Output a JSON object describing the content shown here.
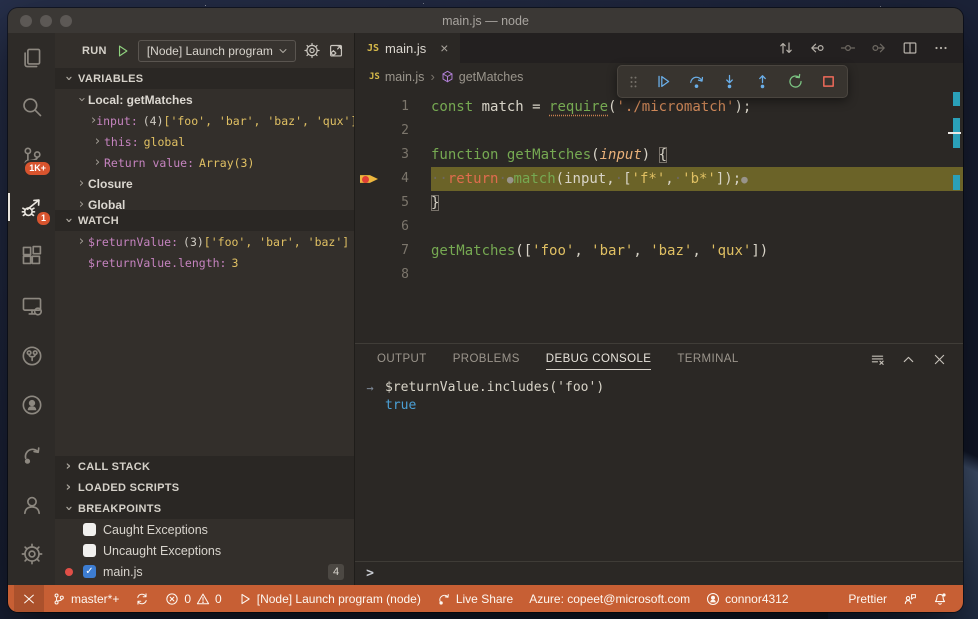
{
  "window_title": "main.js — node",
  "colors": {
    "status_bar": "#c75f34",
    "badge_orange": "#d8542e",
    "debug_blue": "#6aaee8",
    "restart_green": "#7cc583",
    "stop_red": "#ef6a5a",
    "keyword_green": "#76a952",
    "string_yellow": "#e0c063",
    "current_line_highlight": "#6b6328",
    "breakpoint_red": "#e14f47"
  },
  "activity_bar": {
    "items": [
      {
        "name": "explorer",
        "icon": "files-icon"
      },
      {
        "name": "search",
        "icon": "search-icon"
      },
      {
        "name": "source-control",
        "icon": "source-control-icon",
        "badge": "1K+"
      },
      {
        "name": "run-and-debug",
        "icon": "debug-icon",
        "badge": "1",
        "active": true
      },
      {
        "name": "extensions",
        "icon": "extensions-icon"
      },
      {
        "name": "remote-explorer",
        "icon": "remote-explorer-icon"
      },
      {
        "name": "azure-pipelines",
        "icon": "commit-circle-icon"
      },
      {
        "name": "github",
        "icon": "github-icon"
      },
      {
        "name": "live-share",
        "icon": "liveshare-icon"
      },
      {
        "name": "accounts",
        "icon": "account-icon"
      },
      {
        "name": "settings",
        "icon": "gear-icon",
        "bottom": true
      }
    ]
  },
  "run_bar": {
    "label": "RUN",
    "config": "[Node] Launch program"
  },
  "sidebar": {
    "variables": {
      "header": "VARIABLES",
      "expanded": true,
      "rows": [
        {
          "indent": 1,
          "chev": "open",
          "scope": "Local: getMatches"
        },
        {
          "indent": 2,
          "chev": "closed",
          "name": "input:",
          "parts": [
            {
              "t": "(4) ",
              "c": "plain"
            },
            {
              "t": "['foo', 'bar', 'baz', 'qux']",
              "c": "str"
            }
          ]
        },
        {
          "indent": 2,
          "chev": "closed",
          "name": "this:",
          "parts": [
            {
              "t": "global",
              "c": "str"
            }
          ]
        },
        {
          "indent": 2,
          "chev": "closed",
          "name": "Return value:",
          "parts": [
            {
              "t": "Array(3)",
              "c": "str"
            }
          ]
        },
        {
          "indent": 1,
          "chev": "closed",
          "scope": "Closure"
        },
        {
          "indent": 1,
          "chev": "closed",
          "scope": "Global"
        }
      ]
    },
    "watch": {
      "header": "WATCH",
      "expanded": true,
      "rows": [
        {
          "indent": 1,
          "chev": "closed",
          "name": "$returnValue:",
          "parts": [
            {
              "t": "(3) ",
              "c": "plain"
            },
            {
              "t": "['foo', 'bar', 'baz']",
              "c": "str"
            }
          ]
        },
        {
          "indent": 1,
          "chev": "none",
          "name": "$returnValue.length:",
          "parts": [
            {
              "t": "3",
              "c": "num"
            }
          ]
        }
      ]
    },
    "call_stack": {
      "header": "CALL STACK",
      "expanded": false
    },
    "loaded_scripts": {
      "header": "LOADED SCRIPTS",
      "expanded": false
    },
    "breakpoints": {
      "header": "BREAKPOINTS",
      "expanded": true,
      "rows": [
        {
          "label": "Caught Exceptions",
          "checked": false
        },
        {
          "label": "Uncaught Exceptions",
          "checked": false
        },
        {
          "label": "main.js",
          "checked": true,
          "dot": true,
          "badge": "4"
        }
      ]
    }
  },
  "editor": {
    "tab": {
      "label": "main.js",
      "icon": "js-icon",
      "close": "×"
    },
    "breadcrumbs": [
      {
        "icon": "js-icon",
        "label": "main.js"
      },
      {
        "icon": "symbol-icon",
        "label": "getMatches"
      }
    ],
    "actions": [
      {
        "name": "open-changes",
        "icon": "compare-icon"
      },
      {
        "name": "navigate-back",
        "icon": "nav-back-icon"
      },
      {
        "name": "navigate-current",
        "icon": "nav-current-icon",
        "dim": true
      },
      {
        "name": "navigate-forward",
        "icon": "nav-forward-icon",
        "dim": true
      },
      {
        "name": "split-editor",
        "icon": "split-icon"
      },
      {
        "name": "more-actions",
        "icon": "more-icon"
      }
    ],
    "lines": [
      {
        "n": "1",
        "tokens": [
          [
            "kw",
            "const"
          ],
          [
            "fg",
            " match "
          ],
          [
            "fg",
            "= "
          ],
          [
            "req",
            "require"
          ],
          [
            "fg",
            "("
          ],
          [
            "strm",
            "'./micromatch'"
          ],
          [
            "fg",
            ");"
          ]
        ]
      },
      {
        "n": "2",
        "tokens": []
      },
      {
        "n": "3",
        "tokens": [
          [
            "kw",
            "function"
          ],
          [
            "fg",
            " "
          ],
          [
            "fn",
            "getMatches"
          ],
          [
            "fg",
            "("
          ],
          [
            "param",
            "input"
          ],
          [
            "fg",
            ") "
          ],
          [
            "bb",
            "{"
          ]
        ]
      },
      {
        "n": "4",
        "current": true,
        "breakpoint": true,
        "tokens": [
          [
            "ws",
            "··"
          ],
          [
            "ret",
            "return"
          ],
          [
            "ws",
            "·"
          ],
          [
            "dot",
            "●"
          ],
          [
            "fn",
            "match"
          ],
          [
            "fg",
            "(input,"
          ],
          [
            "ws",
            "·"
          ],
          [
            "fg",
            "["
          ],
          [
            "str",
            "'f*'"
          ],
          [
            "fg",
            ","
          ],
          [
            "ws",
            "·"
          ],
          [
            "str",
            "'b*'"
          ],
          [
            "fg",
            "]);"
          ],
          [
            "dot",
            "●"
          ]
        ]
      },
      {
        "n": "5",
        "tokens": [
          [
            "bb",
            "}"
          ]
        ]
      },
      {
        "n": "6",
        "tokens": []
      },
      {
        "n": "7",
        "tokens": [
          [
            "fn",
            "getMatches"
          ],
          [
            "fg",
            "(["
          ],
          [
            "str",
            "'foo'"
          ],
          [
            "fg",
            ", "
          ],
          [
            "str",
            "'bar'"
          ],
          [
            "fg",
            ", "
          ],
          [
            "str",
            "'baz'"
          ],
          [
            "fg",
            ", "
          ],
          [
            "str",
            "'qux'"
          ],
          [
            "fg",
            "])"
          ]
        ]
      },
      {
        "n": "8",
        "tokens": []
      }
    ]
  },
  "debug_toolbar": {
    "buttons": [
      {
        "name": "continue",
        "icon": "continue-icon",
        "color": "blue"
      },
      {
        "name": "step-over",
        "icon": "step-over-icon",
        "color": "blue"
      },
      {
        "name": "step-into",
        "icon": "step-into-icon",
        "color": "blue"
      },
      {
        "name": "step-out",
        "icon": "step-out-icon",
        "color": "blue"
      },
      {
        "name": "restart",
        "icon": "restart-icon",
        "color": "green"
      },
      {
        "name": "stop",
        "icon": "stop-icon",
        "color": "red"
      }
    ]
  },
  "panel": {
    "tabs": [
      {
        "label": "OUTPUT"
      },
      {
        "label": "PROBLEMS"
      },
      {
        "label": "DEBUG CONSOLE",
        "active": true
      },
      {
        "label": "TERMINAL"
      }
    ],
    "console": [
      {
        "type": "input",
        "prompt": "→",
        "text": "$returnValue.includes('foo')"
      },
      {
        "type": "result",
        "text": "true"
      }
    ],
    "input_prompt": ">"
  },
  "status_bar": {
    "left": [
      {
        "name": "remote",
        "emph": true,
        "parts": [
          {
            "icon": "remote-icon"
          }
        ]
      },
      {
        "name": "branch",
        "parts": [
          {
            "icon": "branch-icon"
          },
          {
            "text": "master*+"
          }
        ]
      },
      {
        "name": "sync",
        "parts": [
          {
            "icon": "sync-icon"
          }
        ]
      },
      {
        "name": "problems",
        "parts": [
          {
            "icon": "error-icon"
          },
          {
            "text": "0"
          },
          {
            "icon": "warning-icon"
          },
          {
            "text": "0"
          }
        ]
      },
      {
        "name": "debug-config",
        "parts": [
          {
            "icon": "play-icon"
          },
          {
            "text": "[Node] Launch program (node)"
          }
        ]
      },
      {
        "name": "live-share",
        "parts": [
          {
            "icon": "liveshare-icon"
          },
          {
            "text": "Live Share"
          }
        ]
      },
      {
        "name": "azure-account",
        "parts": [
          {
            "text": "Azure: copeet@microsoft.com"
          }
        ]
      },
      {
        "name": "github-account",
        "parts": [
          {
            "icon": "github-icon"
          },
          {
            "text": "connor4312"
          }
        ]
      }
    ],
    "right": [
      {
        "name": "prettier",
        "parts": [
          {
            "text": "Prettier"
          }
        ]
      },
      {
        "name": "feedback",
        "parts": [
          {
            "icon": "feedback-icon"
          }
        ]
      },
      {
        "name": "notifications",
        "parts": [
          {
            "icon": "bell-icon"
          }
        ]
      }
    ]
  }
}
